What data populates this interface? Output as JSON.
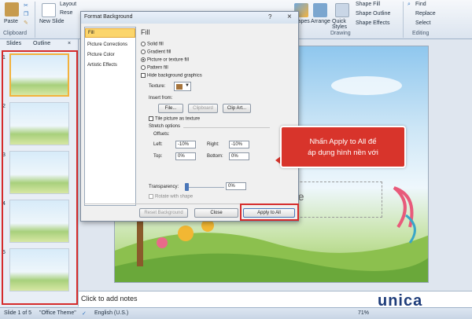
{
  "ribbon": {
    "paste": "Paste",
    "new_slide": "New Slide",
    "layout": "Layout",
    "reset": "Rese",
    "clipboard": "Clipboard",
    "shapes": "Shapes",
    "arrange": "Arrange",
    "quick_styles": "Quick Styles",
    "shape_fill": "Shape Fill",
    "shape_outline": "Shape Outline",
    "shape_effects": "Shape Effects",
    "drawing": "Drawing",
    "find": "Find",
    "replace": "Replace",
    "select": "Select",
    "editing": "Editing"
  },
  "slides_pane": {
    "tab_slides": "Slides",
    "tab_outline": "Outline",
    "close": "×",
    "thumb_numbers": [
      "1",
      "2",
      "3",
      "4",
      "5"
    ]
  },
  "slide": {
    "subtitle_placeholder": "ptitle"
  },
  "notes": {
    "placeholder": "Click to add notes"
  },
  "status": {
    "slide_counter": "Slide 1 of 5",
    "theme": "\"Office Theme\"",
    "language": "English (U.S.)",
    "zoom": "71%"
  },
  "dialog": {
    "title": "Format Background",
    "help": "?",
    "close": "×",
    "nav": [
      "Fill",
      "Picture Corrections",
      "Picture Color",
      "Artistic Effects"
    ],
    "heading": "Fill",
    "solid": "Solid fill",
    "gradient": "Gradient fill",
    "picture": "Picture or texture fill",
    "pattern": "Pattern fill",
    "hide_graphics": "Hide background graphics",
    "texture_label": "Texture:",
    "insert_from": "Insert from:",
    "file_btn": "File...",
    "clipboard_btn": "Clipboard",
    "clipart_btn": "Clip Art...",
    "tile": "Tile picture as texture",
    "stretch": "Stretch options",
    "offsets": "Offsets:",
    "left_label": "Left:",
    "left_val": "-10%",
    "right_label": "Right:",
    "right_val": "-10%",
    "top_label": "Top:",
    "top_val": "0%",
    "bottom_label": "Bottom:",
    "bottom_val": "0%",
    "transparency_label": "Transparency:",
    "transparency_val": "0%",
    "rotate": "Rotate with shape",
    "reset_btn": "Reset Background",
    "close_btn": "Close",
    "apply_all_btn": "Apply to All"
  },
  "callout": {
    "line1": "Nhấn Apply to All để",
    "line2": "áp dụng hình nền với"
  },
  "logo": {
    "text": "unica"
  },
  "colors": {
    "accent_red": "#d52b2b",
    "selection_yellow": "#fbd56b",
    "logo_blue": "#1f3d7a"
  }
}
